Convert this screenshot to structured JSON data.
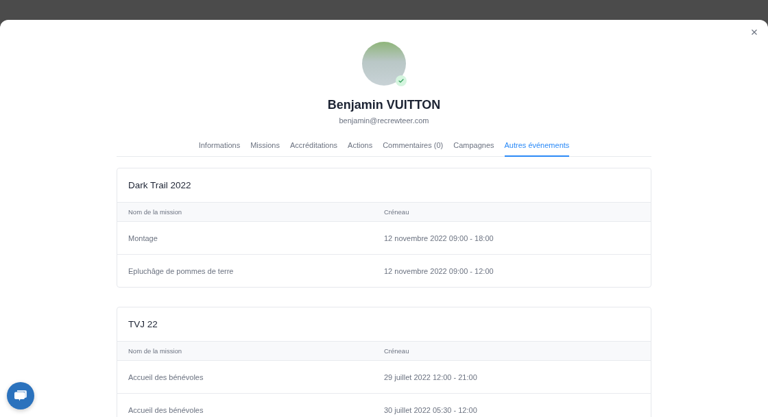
{
  "profile": {
    "name": "Benjamin VUITTON",
    "email": "benjamin@recrewteer.com",
    "verified": true
  },
  "tabs": [
    {
      "label": "Informations",
      "selected": false
    },
    {
      "label": "Missions",
      "selected": false
    },
    {
      "label": "Accréditations",
      "selected": false
    },
    {
      "label": "Actions",
      "selected": false
    },
    {
      "label": "Commentaires (0)",
      "selected": false
    },
    {
      "label": "Campagnes",
      "selected": false
    },
    {
      "label": "Autres événements",
      "selected": true
    }
  ],
  "events": [
    {
      "title": "Dark Trail 2022",
      "columns": [
        "Nom de la mission",
        "Créneau"
      ],
      "rows": [
        [
          "Montage",
          "12 novembre 2022 09:00 - 18:00"
        ],
        [
          "Epluchâge de pommes de terre",
          "12 novembre 2022 09:00 - 12:00"
        ]
      ]
    },
    {
      "title": "TVJ 22",
      "columns": [
        "Nom de la mission",
        "Créneau"
      ],
      "rows": [
        [
          "Accueil des bénévoles",
          "29 juillet 2022 12:00 - 21:00"
        ],
        [
          "Accueil des bénévoles",
          "30 juillet 2022 05:30 - 12:00"
        ]
      ]
    }
  ]
}
